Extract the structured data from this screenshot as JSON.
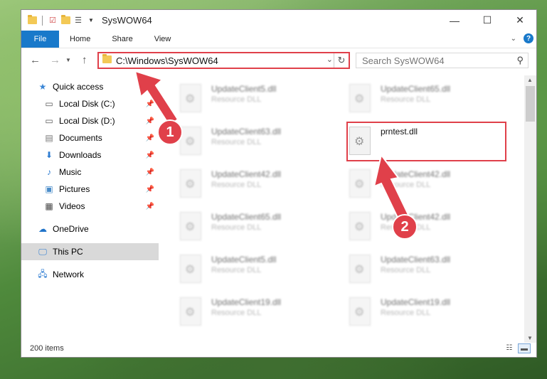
{
  "window": {
    "title": "SysWOW64"
  },
  "ribbon": {
    "file": "File",
    "home": "Home",
    "share": "Share",
    "view": "View"
  },
  "address": {
    "path": "C:\\Windows\\SysWOW64"
  },
  "search": {
    "placeholder": "Search SysWOW64"
  },
  "sidebar": {
    "quick_access": "Quick access",
    "items": [
      {
        "label": "Local Disk (C:)",
        "icon": "drive-icon"
      },
      {
        "label": "Local Disk (D:)",
        "icon": "drive-icon"
      },
      {
        "label": "Documents",
        "icon": "documents-icon"
      },
      {
        "label": "Downloads",
        "icon": "downloads-icon"
      },
      {
        "label": "Music",
        "icon": "music-icon"
      },
      {
        "label": "Pictures",
        "icon": "pictures-icon"
      },
      {
        "label": "Videos",
        "icon": "videos-icon"
      }
    ],
    "onedrive": "OneDrive",
    "this_pc": "This PC",
    "network": "Network"
  },
  "files": [
    {
      "name": "UpdateClient5.dll",
      "type": "Resource DLL"
    },
    {
      "name": "UpdateClient65.dll",
      "type": "Resource DLL"
    },
    {
      "name": "UpdateClient63.dll",
      "type": "Resource DLL"
    },
    {
      "name": "prntest.dll",
      "type": ""
    },
    {
      "name": "UpdateClient42.dll",
      "type": "Resource DLL"
    },
    {
      "name": "UpdateClient42.dll",
      "type": "Resource DLL"
    },
    {
      "name": "UpdateClient65.dll",
      "type": "Resource DLL"
    },
    {
      "name": "UpdateClient42.dll",
      "type": "Resource DLL"
    },
    {
      "name": "UpdateClient5.dll",
      "type": "Resource DLL"
    },
    {
      "name": "UpdateClient63.dll",
      "type": "Resource DLL"
    },
    {
      "name": "UpdateClient19.dll",
      "type": "Resource DLL"
    },
    {
      "name": "UpdateClient19.dll",
      "type": "Resource DLL"
    }
  ],
  "status": {
    "count": "200 items"
  },
  "annotations": {
    "step1": "1",
    "step2": "2",
    "color": "#e0404a"
  }
}
